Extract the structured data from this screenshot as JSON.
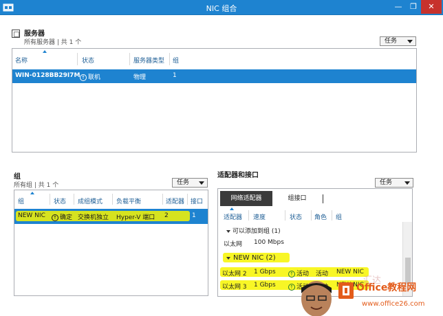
{
  "window": {
    "title": "NIC 组合",
    "min_label": "—",
    "max_label": "❐",
    "close_label": "✕"
  },
  "servers": {
    "title": "服务器",
    "subtitle": "所有服务器 | 共 1 个",
    "tasks_label": "任务",
    "columns": [
      "名称",
      "状态",
      "服务器类型",
      "组"
    ],
    "rows": [
      {
        "name": "WIN-0128BB29I7M",
        "status": "联机",
        "type": "物理",
        "group": "1"
      }
    ]
  },
  "groups": {
    "title": "组",
    "subtitle": "所有组 | 共 1 个",
    "tasks_label": "任务",
    "columns": [
      "组",
      "状态",
      "成组模式",
      "负载平衡",
      "适配器",
      "接口"
    ],
    "rows": [
      {
        "group": "NEW NIC",
        "status": "确定",
        "mode": "交换机独立",
        "balance": "Hyper-V 端口",
        "adapters": "2",
        "interfaces": "1"
      }
    ]
  },
  "adapters": {
    "title": "适配器和接口",
    "tasks_label": "任务",
    "tabs": [
      "网络适配器",
      "组接口"
    ],
    "columns": [
      "适配器",
      "速度",
      "状态",
      "角色",
      "组"
    ],
    "section_available": "可以添加到组 (1)",
    "available_rows": [
      {
        "name": "以太网",
        "speed": "100 Mbps"
      }
    ],
    "section_team": "NEW NIC (2)",
    "team_rows": [
      {
        "name": "以太网 2",
        "speed": "1 Gbps",
        "status": "活动",
        "role": "活动",
        "group": "NEW NIC"
      },
      {
        "name": "以太网 3",
        "speed": "1 Gbps",
        "status": "活动",
        "role": "活动",
        "group": "NEW NIC"
      }
    ]
  },
  "watermark": {
    "brand": "Office教程网",
    "url": "www.office26.com",
    "calligraphy": "汇达"
  },
  "colors": {
    "accent": "#1e83d0",
    "highlight": "#f7f400",
    "close": "#c7322c"
  }
}
